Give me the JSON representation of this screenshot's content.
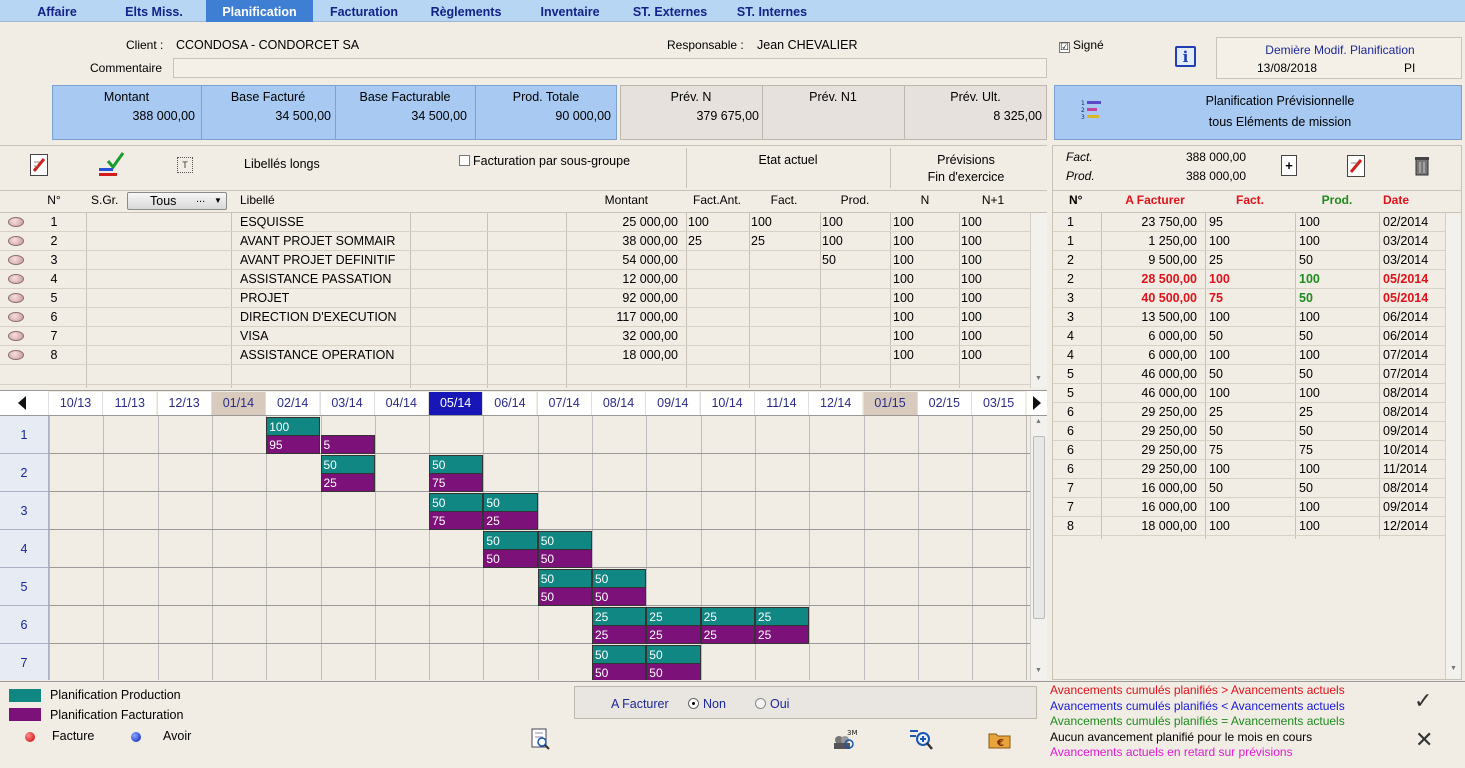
{
  "nav": {
    "tabs": [
      {
        "label": "Affaire",
        "x": 0
      },
      {
        "label": "Elts Miss."
      },
      {
        "label": "Planification",
        "active": true
      },
      {
        "label": "Facturation"
      },
      {
        "label": "Règlements"
      },
      {
        "label": "Inventaire"
      },
      {
        "label": "ST. Externes"
      },
      {
        "label": "ST. Internes"
      }
    ]
  },
  "header": {
    "client_label": "Client :",
    "client_value": "CCONDOSA - CONDORCET SA",
    "resp_label": "Responsable :",
    "resp_value": "Jean CHEVALIER",
    "comment_label": "Commentaire",
    "comment_value": "",
    "signe_label": "Signé",
    "signe_checked": "☑",
    "last_modif_label": "Demière Modif. Planification",
    "last_modif_date": "13/08/2018",
    "last_modif_user": "PI"
  },
  "summary": {
    "montant_label": "Montant",
    "montant": "388 000,00",
    "base_facture_label": "Base Facturé",
    "base_facture": "34 500,00",
    "base_facturable_label": "Base Facturable",
    "base_facturable": "34 500,00",
    "prod_totale_label": "Prod. Totale",
    "prod_totale": "90 000,00",
    "prev_n_label": "Prév. N",
    "prev_n": "379 675,00",
    "prev_n1_label": "Prév. N1",
    "prev_n1": "",
    "prev_ult_label": "Prév. Ult.",
    "prev_ult": "8 325,00",
    "plan_prev_line1": "Planification Prévisionnelle",
    "plan_prev_line2": "tous Eléments de mission"
  },
  "toolbar": {
    "libelles_longs": "Libellés longs",
    "fact_sous_groupe": "Facturation par sous-groupe",
    "etat_actuel": "Etat actuel",
    "previsions_line1": "Prévisions",
    "previsions_line2": "Fin d'exercice"
  },
  "table": {
    "headers": {
      "num": "N°",
      "sgr": "S.Gr.",
      "sgr_select": "Tous",
      "libelle": "Libellé",
      "montant": "Montant",
      "fact_ant": "Fact.Ant.",
      "fact": "Fact.",
      "prod": "Prod.",
      "n": "N",
      "n1": "N+1"
    },
    "rows": [
      {
        "num": "1",
        "libelle": "ESQUISSE",
        "montant": "25 000,00",
        "fact_ant": "100",
        "fact": "100",
        "prod": "100",
        "n": "100",
        "n1": "100"
      },
      {
        "num": "2",
        "libelle": "AVANT PROJET SOMMAIR",
        "montant": "38 000,00",
        "fact_ant": "25",
        "fact": "25",
        "prod": "100",
        "n": "100",
        "n1": "100"
      },
      {
        "num": "3",
        "libelle": "AVANT PROJET DEFINITIF",
        "montant": "54 000,00",
        "fact_ant": "",
        "fact": "",
        "prod": "50",
        "n": "100",
        "n1": "100"
      },
      {
        "num": "4",
        "libelle": "ASSISTANCE PASSATION",
        "montant": "12 000,00",
        "fact_ant": "",
        "fact": "",
        "prod": "",
        "n": "100",
        "n1": "100"
      },
      {
        "num": "5",
        "libelle": "PROJET",
        "montant": "92 000,00",
        "fact_ant": "",
        "fact": "",
        "prod": "",
        "n": "100",
        "n1": "100"
      },
      {
        "num": "6",
        "libelle": "DIRECTION D'EXECUTION",
        "montant": "117 000,00",
        "fact_ant": "",
        "fact": "",
        "prod": "",
        "n": "100",
        "n1": "100"
      },
      {
        "num": "7",
        "libelle": "VISA",
        "montant": "32 000,00",
        "fact_ant": "",
        "fact": "",
        "prod": "",
        "n": "100",
        "n1": "100"
      },
      {
        "num": "8",
        "libelle": "ASSISTANCE OPERATION",
        "montant": "18 000,00",
        "fact_ant": "",
        "fact": "",
        "prod": "",
        "n": "100",
        "n1": "100"
      }
    ]
  },
  "timeline": {
    "months": [
      "10/13",
      "11/13",
      "12/13",
      "01/14",
      "02/14",
      "03/14",
      "04/14",
      "05/14",
      "06/14",
      "07/14",
      "08/14",
      "09/14",
      "10/14",
      "11/14",
      "12/14",
      "01/15",
      "02/15",
      "03/15"
    ],
    "rows": [
      "1",
      "2",
      "3",
      "4",
      "5",
      "6",
      "7"
    ],
    "bars": [
      {
        "row": 0,
        "start": 4,
        "span": 1,
        "prod": "100",
        "fact": "95"
      },
      {
        "row": 0,
        "start": 5,
        "span": 1,
        "prod": null,
        "fact": "5"
      },
      {
        "row": 1,
        "start": 5,
        "span": 1,
        "prod": "50",
        "fact": "25"
      },
      {
        "row": 1,
        "start": 7,
        "span": 1,
        "prod": "50",
        "fact": "75"
      },
      {
        "row": 2,
        "start": 7,
        "span": 1,
        "prod": "50",
        "fact": "75"
      },
      {
        "row": 2,
        "start": 8,
        "span": 1,
        "prod": "50",
        "fact": "25"
      },
      {
        "row": 3,
        "start": 8,
        "span": 1,
        "prod": "50",
        "fact": "50"
      },
      {
        "row": 3,
        "start": 9,
        "span": 1,
        "prod": "50",
        "fact": "50"
      },
      {
        "row": 4,
        "start": 9,
        "span": 1,
        "prod": "50",
        "fact": "50"
      },
      {
        "row": 4,
        "start": 10,
        "span": 1,
        "prod": "50",
        "fact": "50"
      },
      {
        "row": 5,
        "start": 10,
        "span": 1,
        "prod": "25",
        "fact": "25"
      },
      {
        "row": 5,
        "start": 11,
        "span": 1,
        "prod": "25",
        "fact": "25"
      },
      {
        "row": 5,
        "start": 12,
        "span": 1,
        "prod": "25",
        "fact": "25"
      },
      {
        "row": 5,
        "start": 13,
        "span": 1,
        "prod": "25",
        "fact": "25"
      },
      {
        "row": 6,
        "start": 10,
        "span": 1,
        "prod": "50",
        "fact": "50"
      },
      {
        "row": 6,
        "start": 11,
        "span": 1,
        "prod": "50",
        "fact": "50"
      }
    ]
  },
  "right": {
    "fact_label": "Fact.",
    "fact_value": "388 000,00",
    "prod_label": "Prod.",
    "prod_value": "388 000,00",
    "headers": {
      "num": "N°",
      "a_facturer": "A Facturer",
      "fact": "Fact.",
      "prod": "Prod.",
      "date": "Date"
    },
    "rows": [
      {
        "num": "1",
        "a_facturer": "23 750,00",
        "fact": "95",
        "prod": "100",
        "date": "02/2014",
        "style": ""
      },
      {
        "num": "1",
        "a_facturer": "1 250,00",
        "fact": "100",
        "prod": "100",
        "date": "03/2014",
        "style": ""
      },
      {
        "num": "2",
        "a_facturer": "9 500,00",
        "fact": "25",
        "prod": "50",
        "date": "03/2014",
        "style": ""
      },
      {
        "num": "2",
        "a_facturer": "28 500,00",
        "fact": "100",
        "prod": "100",
        "date": "05/2014",
        "style": "red"
      },
      {
        "num": "3",
        "a_facturer": "40 500,00",
        "fact": "75",
        "prod": "50",
        "date": "05/2014",
        "style": "redgreen"
      },
      {
        "num": "3",
        "a_facturer": "13 500,00",
        "fact": "100",
        "prod": "100",
        "date": "06/2014",
        "style": ""
      },
      {
        "num": "4",
        "a_facturer": "6 000,00",
        "fact": "50",
        "prod": "50",
        "date": "06/2014",
        "style": ""
      },
      {
        "num": "4",
        "a_facturer": "6 000,00",
        "fact": "100",
        "prod": "100",
        "date": "07/2014",
        "style": ""
      },
      {
        "num": "5",
        "a_facturer": "46 000,00",
        "fact": "50",
        "prod": "50",
        "date": "07/2014",
        "style": ""
      },
      {
        "num": "5",
        "a_facturer": "46 000,00",
        "fact": "100",
        "prod": "100",
        "date": "08/2014",
        "style": ""
      },
      {
        "num": "6",
        "a_facturer": "29 250,00",
        "fact": "25",
        "prod": "25",
        "date": "08/2014",
        "style": ""
      },
      {
        "num": "6",
        "a_facturer": "29 250,00",
        "fact": "50",
        "prod": "50",
        "date": "09/2014",
        "style": ""
      },
      {
        "num": "6",
        "a_facturer": "29 250,00",
        "fact": "75",
        "prod": "75",
        "date": "10/2014",
        "style": ""
      },
      {
        "num": "6",
        "a_facturer": "29 250,00",
        "fact": "100",
        "prod": "100",
        "date": "11/2014",
        "style": ""
      },
      {
        "num": "7",
        "a_facturer": "16 000,00",
        "fact": "50",
        "prod": "50",
        "date": "08/2014",
        "style": ""
      },
      {
        "num": "7",
        "a_facturer": "16 000,00",
        "fact": "100",
        "prod": "100",
        "date": "09/2014",
        "style": ""
      },
      {
        "num": "8",
        "a_facturer": "18 000,00",
        "fact": "100",
        "prod": "100",
        "date": "12/2014",
        "style": ""
      }
    ]
  },
  "footer": {
    "legend_prod": "Planification Production",
    "legend_fact": "Planification Facturation",
    "facture": "Facture",
    "avoir": "Avoir",
    "a_facturer": "A Facturer",
    "non": "Non",
    "oui": "Oui",
    "msgs": [
      {
        "text": "Avancements cumulés planifiés > Avancements actuels",
        "color": "#e0121a"
      },
      {
        "text": "Avancements cumulés planifiés < Avancements actuels",
        "color": "#1a1ad8"
      },
      {
        "text": "Avancements cumulés planifiés = Avancements actuels",
        "color": "#1d8c1d"
      },
      {
        "text": "Aucun avancement planifié pour le mois en cours",
        "color": "#000000"
      },
      {
        "text": "Avancements actuels en retard sur prévisions",
        "color": "#e01ad8"
      }
    ],
    "ok_symbol": "✓",
    "cancel_symbol": "✕"
  },
  "colors": {
    "teal": "#108783",
    "purple": "#7c117a",
    "nav_bg": "#b7d6f3",
    "active_tab": "#3f7fd3",
    "selected_month": "#1816b6",
    "shaded_month": "#d8cbbd"
  }
}
